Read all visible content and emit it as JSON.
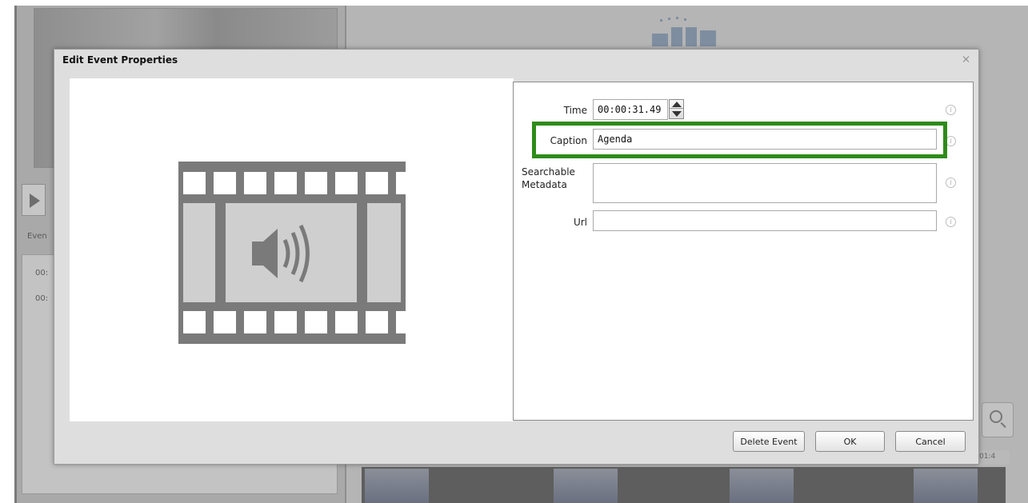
{
  "background": {
    "events_label": "Even",
    "list_rows": [
      "00:",
      "00:"
    ],
    "timeline_time": "01:4"
  },
  "dialog": {
    "title": "Edit Event Properties",
    "fields": {
      "time": {
        "label": "Time",
        "value": "00:00:31.49"
      },
      "caption": {
        "label": "Caption",
        "value": "Agenda"
      },
      "metadata": {
        "label_line1": "Searchable",
        "label_line2": "Metadata",
        "value": ""
      },
      "url": {
        "label": "Url",
        "value": ""
      }
    },
    "info_glyph": "i",
    "buttons": {
      "delete": "Delete Event",
      "ok": "OK",
      "cancel": "Cancel"
    }
  },
  "colors": {
    "highlight": "#2e8b1a",
    "icon_gray": "#7a7a7a"
  },
  "icons": [
    "film-audio-icon",
    "info-icon",
    "close-icon",
    "spinner-up-icon",
    "spinner-down-icon",
    "play-icon",
    "zoom-icon"
  ]
}
